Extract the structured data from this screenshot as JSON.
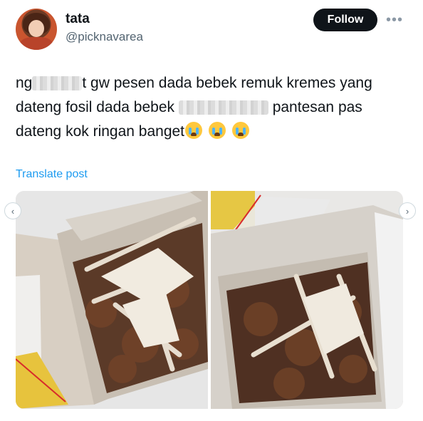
{
  "tweet": {
    "author": {
      "display_name": "tata",
      "handle": "@picknavarea"
    },
    "follow_label": "Follow",
    "more_icon": "more-horizontal-icon",
    "text_lines": [
      {
        "before": "ng",
        "after": "t gw pesen dada bebek remuk kremes yang"
      },
      {
        "before": "dateng fosil dada bebek ",
        "after": " pantesan pas"
      },
      {
        "before": "dateng kok ringan banget",
        "after": ""
      }
    ],
    "emoji": [
      "loudly-crying-face",
      "loudly-crying-face",
      "loudly-crying-face"
    ],
    "translate_label": "Translate post",
    "media": [
      {
        "description_icon": "photo-food-box-1"
      },
      {
        "description_icon": "photo-food-box-2"
      }
    ],
    "nav": {
      "prev_icon": "chevron-left-icon",
      "next_icon": "chevron-right-icon"
    }
  },
  "colors": {
    "accent": "#1d9bf0",
    "text": "#0f1419",
    "muted": "#536471",
    "follow_bg": "#0f1419"
  }
}
